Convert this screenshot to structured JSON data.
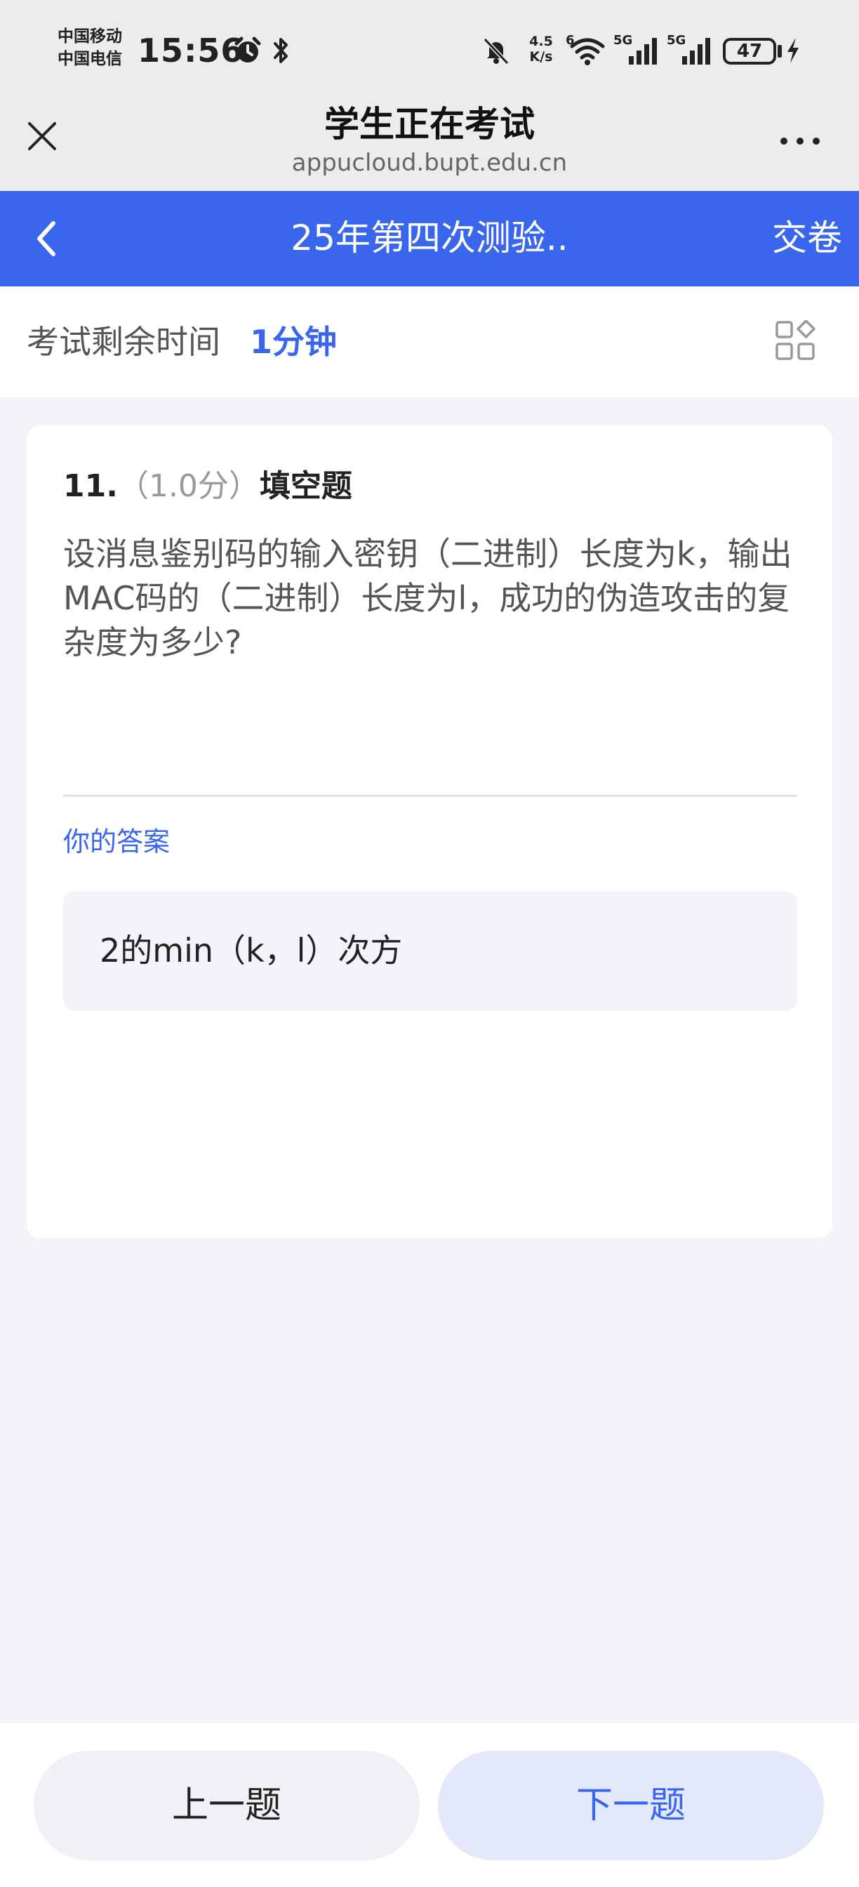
{
  "status_bar": {
    "carrier_1": "中国移动",
    "carrier_2": "中国电信",
    "time": "15:56",
    "net_speed_value": "4.5",
    "net_speed_unit": "K/s",
    "wifi_badge": "6",
    "signal_1_label": "5G",
    "signal_2_label": "5G",
    "battery": "47",
    "icons": [
      "alarm-icon",
      "bluetooth-icon",
      "mute-icon",
      "wifi-icon",
      "signal-icon",
      "battery-icon",
      "charging-icon"
    ]
  },
  "browser": {
    "title": "学生正在考试",
    "domain": "appucloud.bupt.edu.cn"
  },
  "header": {
    "title": "25年第四次测验..",
    "submit_label": "交卷",
    "color": "#3a66ee"
  },
  "timer": {
    "label": "考试剩余时间",
    "value": "1分钟"
  },
  "question": {
    "number": "11.",
    "score": "（1.0分）",
    "type": "填空题",
    "text": "设消息鉴别码的输入密钥（二进制）长度为k，输出MAC码的（二进制）长度为l，成功的伪造攻击的复杂度为多少?"
  },
  "answer": {
    "label": "你的答案",
    "value": "2的min（k，l）次方"
  },
  "nav": {
    "prev_label": "上一题",
    "next_label": "下一题"
  }
}
